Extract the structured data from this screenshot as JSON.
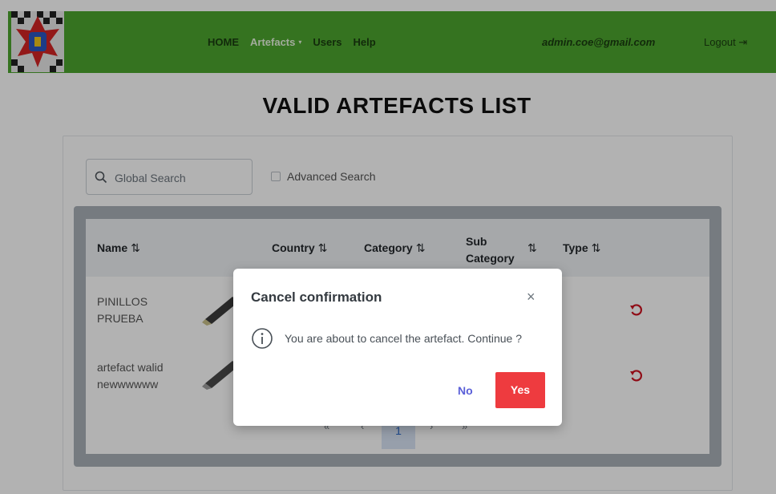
{
  "nav": {
    "home": "HOME",
    "artefacts": "Artefacts",
    "caret": "▾",
    "users": "Users",
    "help": "Help",
    "email": "admin.coe@gmail.com",
    "logout": "Logout",
    "logout_icon": "⇥"
  },
  "page": {
    "title": "VALID ARTEFACTS LIST"
  },
  "search": {
    "placeholder": "Global Search",
    "advanced": "Advanced Search"
  },
  "table": {
    "columns": {
      "name": "Name",
      "country": "Country",
      "category": "Category",
      "subcategory_1": "Sub",
      "subcategory_2": "Category",
      "type": "Type"
    },
    "sort_icon": "⇅",
    "rows": [
      {
        "name_1": "PINILLOS",
        "name_2": "PRUEBA"
      },
      {
        "name_1": "artefact walid",
        "name_2": "newwwwww"
      }
    ]
  },
  "pager": {
    "first": "«",
    "prev": "‹",
    "page": "1",
    "next": "›",
    "last": "»"
  },
  "modal": {
    "title": "Cancel confirmation",
    "close": "×",
    "message": "You are about to cancel the artefact. Continue ?",
    "no": "No",
    "yes": "Yes"
  },
  "colors": {
    "navbar": "#4ca52e",
    "yes_button": "#ee3b3f",
    "no_link": "#5a5fd8",
    "undo_icon": "#cf1322"
  },
  "icons": [
    "search-icon",
    "logout-icon",
    "sort-icon",
    "undo-icon",
    "info-icon",
    "close-icon"
  ]
}
